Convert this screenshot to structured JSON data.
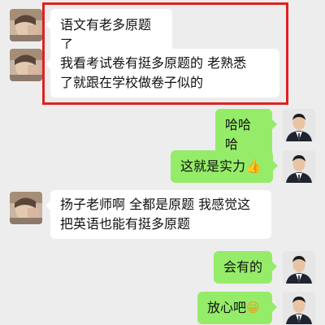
{
  "chat": {
    "messages": [
      {
        "side": "left",
        "text": "语文有老多原题了"
      },
      {
        "side": "left",
        "lines": [
          "我看考试卷有挺多原题的 老熟悉",
          "了就跟在学校做卷子似的"
        ]
      },
      {
        "side": "right",
        "text": "哈哈哈"
      },
      {
        "side": "right",
        "text": "这就是实力",
        "emoji": "👍"
      },
      {
        "side": "left",
        "lines": [
          "扬子老师啊 全都是原题 我感觉这",
          "把英语也能有挺多原题"
        ]
      },
      {
        "side": "right",
        "text": "会有的"
      },
      {
        "side": "right",
        "text": "放心吧",
        "emoji": "😁"
      }
    ]
  },
  "colors": {
    "background": "#ededed",
    "incoming_bubble": "#ffffff",
    "outgoing_bubble": "#95ec69",
    "highlight_border": "#e02020"
  },
  "icons": {
    "left_avatar": "sender-photo-avatar",
    "right_avatar": "suit-man-avatar"
  }
}
